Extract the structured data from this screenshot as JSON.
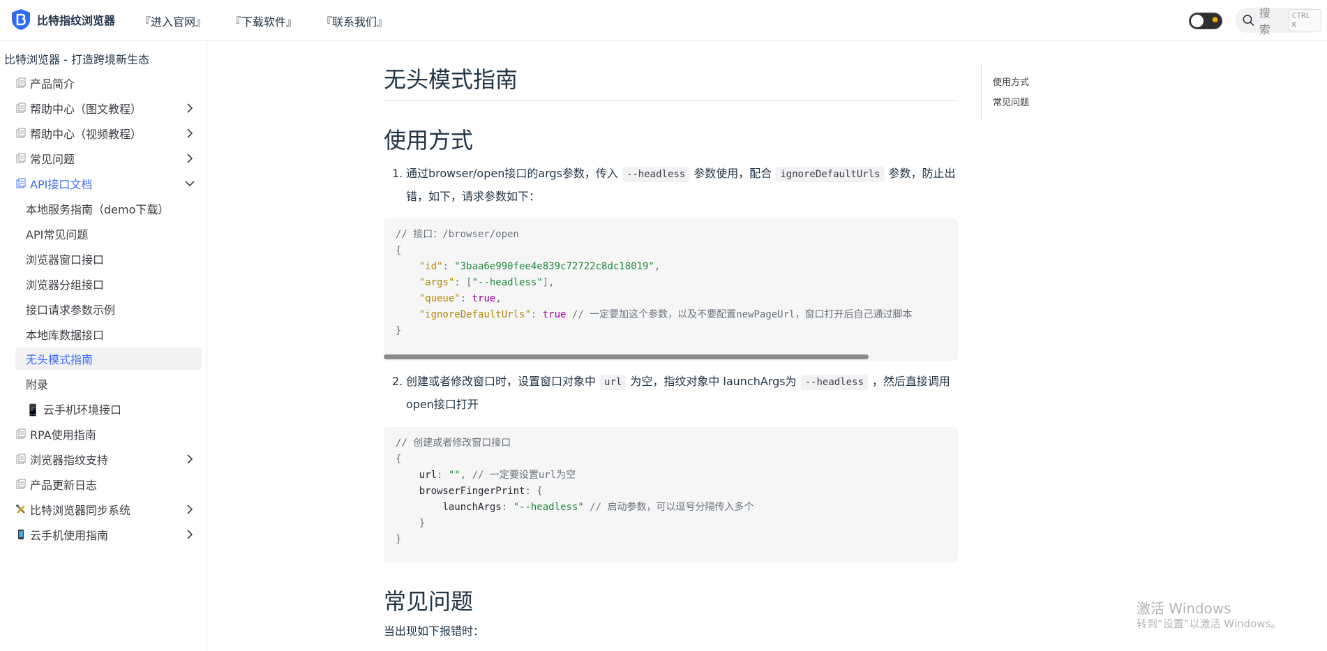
{
  "navbar": {
    "logo_text": "比特指纹浏览器",
    "links": [
      "『进入官网』",
      "『下载软件』",
      "『联系我们』"
    ],
    "search_placeholder": "搜索",
    "search_shortcut": "CTRL K",
    "theme_toggle_icon": "sun-icon"
  },
  "sidebar": {
    "title": "比特浏览器 - 打造跨境新生态",
    "items": [
      {
        "label": "产品简介",
        "icon": "doc-icon",
        "expandable": false
      },
      {
        "label": "帮助中心（图文教程）",
        "icon": "doc-icon",
        "expandable": true
      },
      {
        "label": "帮助中心（视频教程）",
        "icon": "doc-icon",
        "expandable": true
      },
      {
        "label": "常见问题",
        "icon": "doc-icon",
        "expandable": true
      },
      {
        "label": "API接口文档",
        "icon": "doc-icon",
        "expandable": true,
        "expanded": true
      }
    ],
    "sub_items": [
      "本地服务指南（demo下载）",
      "API常见问题",
      "浏览器窗口接口",
      "浏览器分组接口",
      "接口请求参数示例",
      "本地库数据接口",
      "无头模式指南",
      "附录",
      "📱 云手机环境接口"
    ],
    "active_sub": "无头模式指南",
    "bottom_items": [
      {
        "label": "RPA使用指南",
        "icon": "doc-icon",
        "expandable": false
      },
      {
        "label": "浏览器指纹支持",
        "icon": "doc-icon",
        "expandable": true
      },
      {
        "label": "产品更新日志",
        "icon": "doc-icon",
        "expandable": false
      },
      {
        "label": "比特浏览器同步系统",
        "icon": "tools-icon",
        "expandable": true
      },
      {
        "label": "云手机使用指南",
        "icon": "phone-icon",
        "expandable": true
      }
    ]
  },
  "main": {
    "title": "无头模式指南",
    "section1_title": "使用方式",
    "step1": {
      "num": "1.",
      "text_a": "通过browser/open接口的args参数，传入",
      "code_a": "--headless",
      "text_b": "参数使用，配合",
      "code_b": "ignoreDefaultUrls",
      "text_c": "参数，防止出错，如下，请求参数如下："
    },
    "code1": {
      "comment": "// 接口：/browser/open",
      "open": "{",
      "id_key": "\"id\"",
      "id_val": "\"3baa6e990fee4e839c72722c8dc18019\"",
      "args_key": "\"args\"",
      "args_val": "\"--headless\"",
      "queue_key": "\"queue\"",
      "queue_val": "true",
      "ign_key": "\"ignoreDefaultUrls\"",
      "ign_val": "true",
      "ign_comment": "// 一定要加这个参数，以及不要配置newPageUrl，窗口打开后自己通过脚本",
      "close": "}"
    },
    "step2": {
      "num": "2.",
      "text_a": "创建或者修改窗口时，设置窗口对象中",
      "code_a": "url",
      "text_b": "为空，指纹对象中 launchArgs为",
      "code_b": "--headless",
      "text_c": "，然后直接调用open接口打开"
    },
    "code2": {
      "comment": "// 创建或者修改窗口接口",
      "open": "{",
      "url_key": "url",
      "url_val": "\"\"",
      "url_comment": "// 一定要设置url为空",
      "bfp_key": "browserFingerPrint",
      "la_key": "launchArgs",
      "la_val": "\"--headless\"",
      "la_comment": "// 启动参数，可以逗号分隔传入多个",
      "inner_close": "}",
      "close": "}"
    },
    "section2_title": "常见问题",
    "faq_text": "当出现如下报错时："
  },
  "toc": {
    "items": [
      "使用方式",
      "常见问题"
    ]
  },
  "watermark": {
    "line1": "激活 Windows",
    "line2": "转到“设置”以激活 Windows。"
  }
}
